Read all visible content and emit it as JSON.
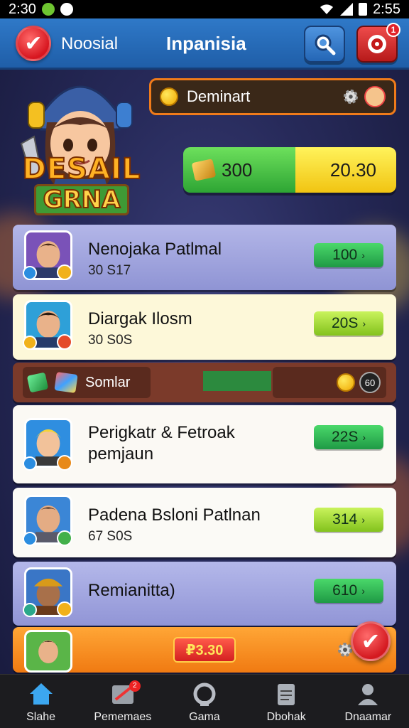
{
  "status_bar": {
    "time_left": "2:30",
    "time_right": "2:55"
  },
  "header": {
    "left_label": "Noosial",
    "title": "Inpanisia"
  },
  "header_badge": "1",
  "logo": {
    "line1": "DESAIL",
    "line2": "GRNA"
  },
  "player": {
    "name": "Deminart"
  },
  "resources": {
    "gold": "300",
    "energy": "20.30"
  },
  "rows": [
    {
      "name": "Nenojaka Patlmal",
      "sub": "30 S17",
      "value": "100",
      "pill_color": "green"
    },
    {
      "name": "Diargak Ilosm",
      "sub": "30 S0S",
      "value": "20S",
      "pill_color": "lime"
    },
    {
      "name": "Perigkatr & Fetroak\npemjaun",
      "sub": "",
      "value": "22S",
      "pill_color": "green"
    },
    {
      "name": "Padena Bsloni Patlnan",
      "sub": "67 S0S",
      "value": "314",
      "pill_color": "lime"
    },
    {
      "name": "Remianitta)",
      "sub": "",
      "value": "610",
      "pill_color": "green"
    }
  ],
  "special_row": {
    "label": "Somlar",
    "count": "60"
  },
  "last_row": {
    "price": "₽3.30"
  },
  "bottom_nav": [
    {
      "label": "Slahe",
      "icon": "home-icon"
    },
    {
      "label": "Pememaes",
      "icon": "inbox-icon",
      "badge": "2"
    },
    {
      "label": "Gama",
      "icon": "gamepad-icon"
    },
    {
      "label": "Dbohak",
      "icon": "document-icon"
    },
    {
      "label": "Dnaamar",
      "icon": "profile-icon"
    }
  ],
  "colors": {
    "header": "#2f79c8",
    "accent_red": "#d7161f",
    "accent_orange": "#f07b1a",
    "pill_green": "#1f9a45",
    "pill_lime": "#83c21d"
  }
}
